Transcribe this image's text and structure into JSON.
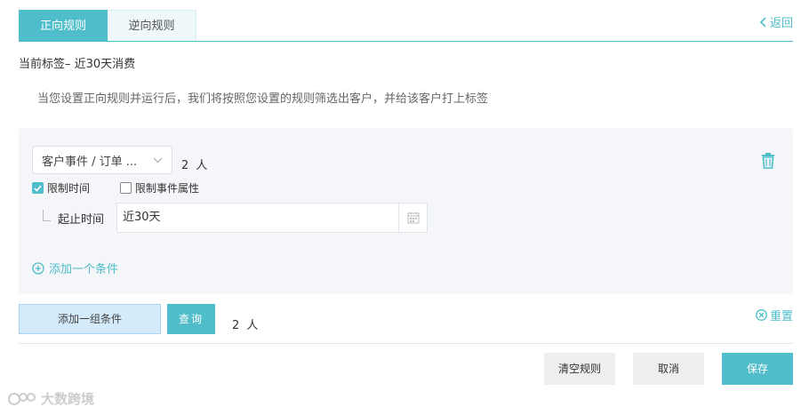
{
  "tabs": [
    {
      "label": "正向规则",
      "active": true
    },
    {
      "label": "逆向规则",
      "active": false
    }
  ],
  "header": {
    "back_label": "返回",
    "current_tag": "当前标签– 近30天消费"
  },
  "description": "当您设置正向规则并运行后，我们将按照您设置的规则筛选出客户，并给该客户打上标签",
  "condition_group": {
    "event_select_value": "客户事件 / 订单 ...",
    "count_text": "2  人",
    "checkboxes": [
      {
        "label": "限制时间",
        "checked": true
      },
      {
        "label": "限制事件属性",
        "checked": false
      }
    ],
    "time_label": "起止时间",
    "time_value": "近30天",
    "add_condition_label": "添加一个条件"
  },
  "actions": {
    "add_group_label": "添加一组条件",
    "query_label": "查询",
    "count_text": "2  人",
    "reset_label": "重置"
  },
  "footer": {
    "clear_label": "清空规则",
    "cancel_label": "取消",
    "save_label": "保存"
  },
  "watermark": {
    "text": "大数跨境"
  },
  "colors": {
    "accent": "#4fbdca",
    "add_group_bg": "#d4ebfb",
    "panel_bg": "#f4f6f9"
  }
}
